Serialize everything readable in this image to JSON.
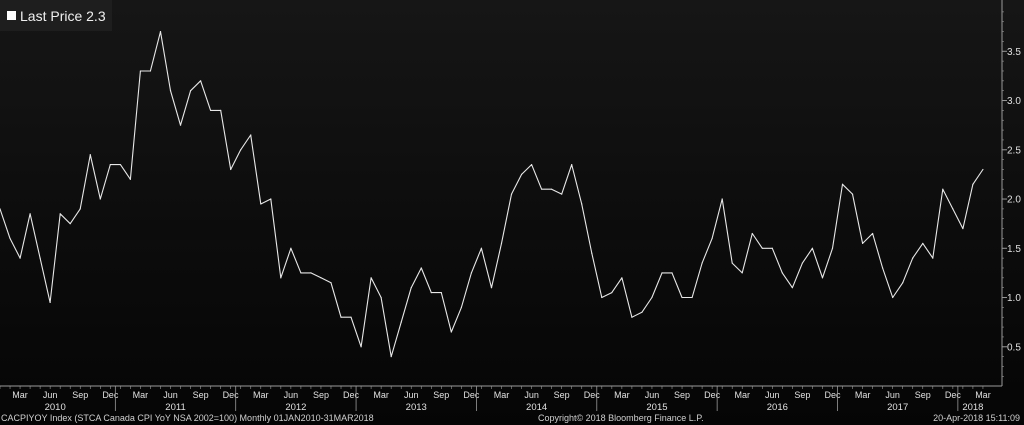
{
  "legend": {
    "label": "Last Price 2.3",
    "swatch_color": "#ffffff"
  },
  "footer": {
    "left": "CACPIYOY Index (STCA Canada CPI YoY NSA 2002=100)  Monthly 01JAN2010-31MAR2018",
    "center": "Copyright© 2018 Bloomberg Finance L.P.",
    "right": "20-Apr-2018 15:11:09"
  },
  "colors": {
    "line": "#e8e8e8",
    "axis": "#9a9a9a",
    "text": "#e0e0e0"
  },
  "chart_data": {
    "type": "line",
    "title": "",
    "xlabel": "",
    "ylabel": "",
    "ylim": [
      0.05,
      3.98
    ],
    "y_ticks": [
      0.5,
      1.0,
      1.5,
      2.0,
      2.5,
      3.0,
      3.5
    ],
    "y_tick_labels": [
      "0.5",
      "1.0",
      "1.5",
      "2.0",
      "2.5",
      "3.0",
      "3.5"
    ],
    "y_axis_side": "right",
    "grid": false,
    "legend_position": "top-left",
    "x_start": "2010-01",
    "x_end": "2018-03",
    "x_month_labels": [
      "Mar",
      "Jun",
      "Sep",
      "Dec"
    ],
    "x_year_labels": [
      "2010",
      "2011",
      "2012",
      "2013",
      "2014",
      "2015",
      "2016",
      "2017",
      "2018"
    ],
    "series": [
      {
        "values": [
          1.9,
          1.6,
          1.4,
          1.85,
          1.4,
          0.95,
          1.85,
          1.75,
          1.9,
          2.45,
          2.0,
          2.35,
          2.35,
          2.2,
          3.3,
          3.3,
          3.7,
          3.1,
          2.75,
          3.1,
          3.2,
          2.9,
          2.9,
          2.3,
          2.5,
          2.65,
          1.95,
          2.0,
          1.2,
          1.5,
          1.25,
          1.25,
          1.2,
          1.15,
          0.8,
          0.8,
          0.5,
          1.2,
          1.0,
          0.4,
          0.75,
          1.1,
          1.3,
          1.05,
          1.05,
          0.65,
          0.9,
          1.25,
          1.5,
          1.1,
          1.55,
          2.05,
          2.25,
          2.35,
          2.1,
          2.1,
          2.05,
          2.35,
          1.95,
          1.45,
          1.0,
          1.05,
          1.2,
          0.8,
          0.85,
          1.0,
          1.25,
          1.25,
          1.0,
          1.0,
          1.35,
          1.6,
          2.0,
          1.35,
          1.25,
          1.65,
          1.5,
          1.5,
          1.25,
          1.1,
          1.35,
          1.5,
          1.2,
          1.5,
          2.15,
          2.05,
          1.55,
          1.65,
          1.3,
          1.0,
          1.15,
          1.4,
          1.55,
          1.4,
          2.1,
          1.9,
          1.7,
          2.15,
          2.3
        ]
      }
    ]
  }
}
